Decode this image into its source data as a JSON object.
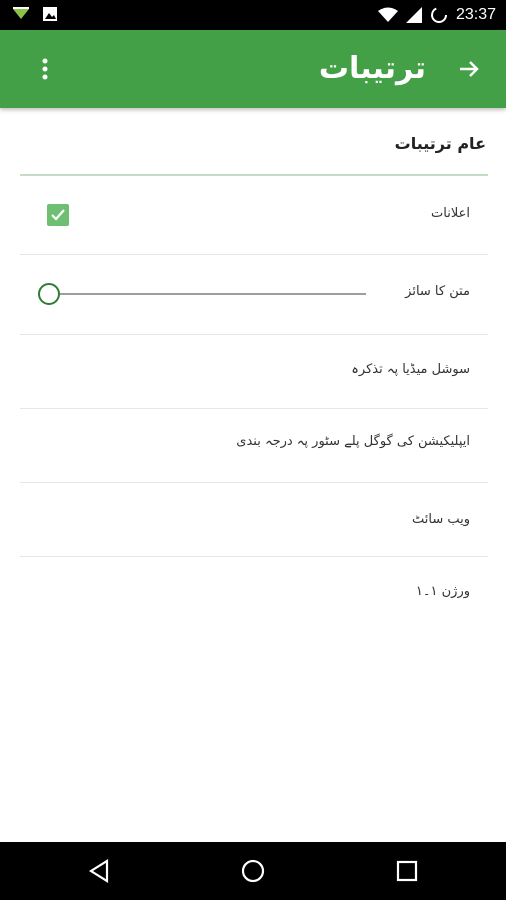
{
  "status_bar": {
    "time": "23:37",
    "icons": [
      "download-icon",
      "image-icon",
      "wifi-icon",
      "signal-icon",
      "battery-loading-icon"
    ]
  },
  "app_bar": {
    "title": "ترتیبات",
    "back_icon": "arrow-right-icon",
    "menu_icon": "more-vert-icon"
  },
  "settings": {
    "section_header": "عام ترتیبات",
    "items": [
      {
        "label": "اعلانات",
        "control": "checkbox",
        "checked": true
      },
      {
        "label": "متن کا سائز",
        "control": "slider",
        "value": 0
      },
      {
        "label": "سوشل میڈیا پہ تذکرہ"
      },
      {
        "label": "ایپلیکیشن کی گوگل پلے سٹور پہ درجہ بندی"
      },
      {
        "label": "ویب سائٹ"
      },
      {
        "label": "ورژن ۱۔۱"
      }
    ]
  },
  "colors": {
    "primary": "#43a047",
    "checkbox": "#6fbf73",
    "slider_thumb": "#2e7d32"
  },
  "nav_bar": {
    "buttons": [
      "back-triangle-icon",
      "home-circle-icon",
      "recents-square-icon"
    ]
  }
}
